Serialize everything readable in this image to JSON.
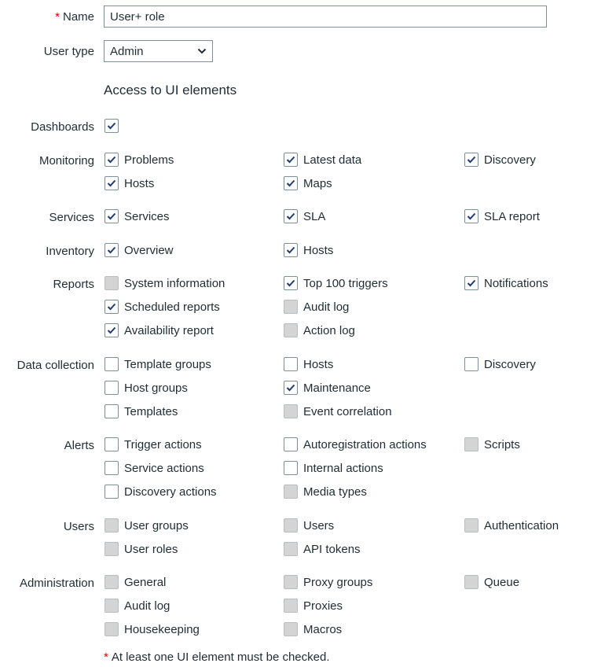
{
  "form": {
    "name_label": "Name",
    "required_mark": "*",
    "name_value": "User+ role",
    "user_type_label": "User type",
    "user_type_value": "Admin",
    "section_title": "Access to UI elements",
    "footnote": "At least one UI element must be checked."
  },
  "groups": [
    {
      "label": "Dashboards",
      "items": [
        {
          "label": "",
          "state": "checked",
          "col": 0,
          "row": 0
        }
      ]
    },
    {
      "label": "Monitoring",
      "items": [
        {
          "label": "Problems",
          "state": "checked",
          "col": 0,
          "row": 0
        },
        {
          "label": "Latest data",
          "state": "checked",
          "col": 1,
          "row": 0
        },
        {
          "label": "Discovery",
          "state": "checked",
          "col": 2,
          "row": 0
        },
        {
          "label": "Hosts",
          "state": "checked",
          "col": 0,
          "row": 1
        },
        {
          "label": "Maps",
          "state": "checked",
          "col": 1,
          "row": 1
        }
      ]
    },
    {
      "label": "Services",
      "items": [
        {
          "label": "Services",
          "state": "checked",
          "col": 0,
          "row": 0
        },
        {
          "label": "SLA",
          "state": "checked",
          "col": 1,
          "row": 0
        },
        {
          "label": "SLA report",
          "state": "checked",
          "col": 2,
          "row": 0
        }
      ]
    },
    {
      "label": "Inventory",
      "items": [
        {
          "label": "Overview",
          "state": "checked",
          "col": 0,
          "row": 0
        },
        {
          "label": "Hosts",
          "state": "checked",
          "col": 1,
          "row": 0
        }
      ]
    },
    {
      "label": "Reports",
      "items": [
        {
          "label": "System information",
          "state": "disabled",
          "col": 0,
          "row": 0
        },
        {
          "label": "Top 100 triggers",
          "state": "checked",
          "col": 1,
          "row": 0
        },
        {
          "label": "Notifications",
          "state": "checked",
          "col": 2,
          "row": 0
        },
        {
          "label": "Scheduled reports",
          "state": "checked",
          "col": 0,
          "row": 1
        },
        {
          "label": "Audit log",
          "state": "disabled",
          "col": 1,
          "row": 1
        },
        {
          "label": "Availability report",
          "state": "checked",
          "col": 0,
          "row": 2
        },
        {
          "label": "Action log",
          "state": "disabled",
          "col": 1,
          "row": 2
        }
      ]
    },
    {
      "label": "Data collection",
      "items": [
        {
          "label": "Template groups",
          "state": "unchecked",
          "col": 0,
          "row": 0
        },
        {
          "label": "Hosts",
          "state": "unchecked",
          "col": 1,
          "row": 0
        },
        {
          "label": "Discovery",
          "state": "unchecked",
          "col": 2,
          "row": 0
        },
        {
          "label": "Host groups",
          "state": "unchecked",
          "col": 0,
          "row": 1
        },
        {
          "label": "Maintenance",
          "state": "checked",
          "col": 1,
          "row": 1
        },
        {
          "label": "Templates",
          "state": "unchecked",
          "col": 0,
          "row": 2
        },
        {
          "label": "Event correlation",
          "state": "disabled",
          "col": 1,
          "row": 2
        }
      ]
    },
    {
      "label": "Alerts",
      "items": [
        {
          "label": "Trigger actions",
          "state": "unchecked",
          "col": 0,
          "row": 0
        },
        {
          "label": "Autoregistration actions",
          "state": "unchecked",
          "col": 1,
          "row": 0
        },
        {
          "label": "Scripts",
          "state": "disabled",
          "col": 2,
          "row": 0
        },
        {
          "label": "Service actions",
          "state": "unchecked",
          "col": 0,
          "row": 1
        },
        {
          "label": "Internal actions",
          "state": "unchecked",
          "col": 1,
          "row": 1
        },
        {
          "label": "Discovery actions",
          "state": "unchecked",
          "col": 0,
          "row": 2
        },
        {
          "label": "Media types",
          "state": "disabled",
          "col": 1,
          "row": 2
        }
      ]
    },
    {
      "label": "Users",
      "items": [
        {
          "label": "User groups",
          "state": "disabled",
          "col": 0,
          "row": 0
        },
        {
          "label": "Users",
          "state": "disabled",
          "col": 1,
          "row": 0
        },
        {
          "label": "Authentication",
          "state": "disabled",
          "col": 2,
          "row": 0
        },
        {
          "label": "User roles",
          "state": "disabled",
          "col": 0,
          "row": 1
        },
        {
          "label": "API tokens",
          "state": "disabled",
          "col": 1,
          "row": 1
        }
      ]
    },
    {
      "label": "Administration",
      "items": [
        {
          "label": "General",
          "state": "disabled",
          "col": 0,
          "row": 0
        },
        {
          "label": "Proxy groups",
          "state": "disabled",
          "col": 1,
          "row": 0
        },
        {
          "label": "Queue",
          "state": "disabled",
          "col": 2,
          "row": 0
        },
        {
          "label": "Audit log",
          "state": "disabled",
          "col": 0,
          "row": 1
        },
        {
          "label": "Proxies",
          "state": "disabled",
          "col": 1,
          "row": 1
        },
        {
          "label": "Housekeeping",
          "state": "disabled",
          "col": 0,
          "row": 2
        },
        {
          "label": "Macros",
          "state": "disabled",
          "col": 1,
          "row": 2
        }
      ]
    }
  ]
}
